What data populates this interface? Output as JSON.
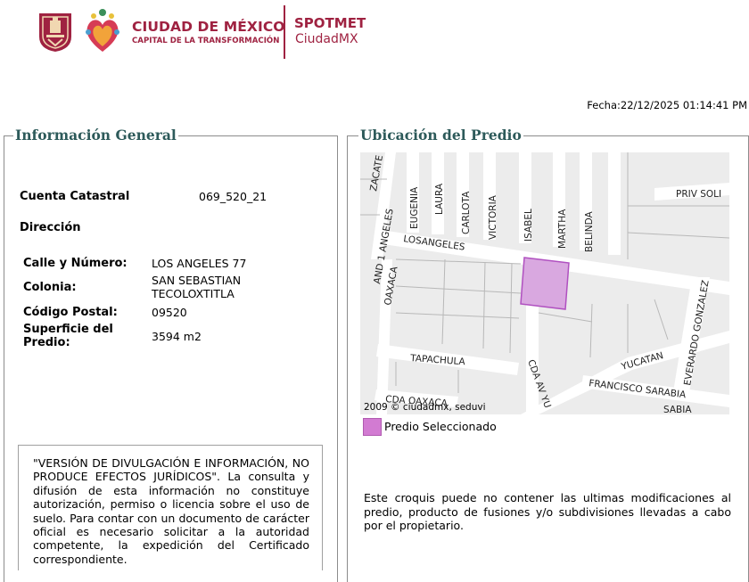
{
  "header": {
    "brand_title": "CIUDAD DE MÉXICO",
    "brand_subtitle": "CAPITAL DE LA TRANSFORMACIÓN",
    "app_title": "SPOTMET",
    "app_subtitle": "CiudadMX",
    "brand_color": "#9f2241",
    "icons": [
      "cdmx-crest-icon",
      "heart-emblem-icon"
    ]
  },
  "fecha": "Fecha:22/12/2025 01:14:41 PM",
  "info_general": {
    "legend": "Información General",
    "cuenta_label": "Cuenta Catastral",
    "cuenta_value": "069_520_21",
    "direccion_label": "Dirección",
    "calle_label": "Calle y Número:",
    "calle_value": "LOS ANGELES 77",
    "colonia_label": "Colonia:",
    "colonia_line1": "SAN SEBASTIAN",
    "colonia_line2": "TECOLOXTITLA",
    "cp_label": "Código Postal:",
    "cp_value": "09520",
    "superficie_label_1": "Superficie del",
    "superficie_label_2": "Predio:",
    "superficie_value": "3594 m2"
  },
  "disclaimer": "\"VERSIÓN DE DIVULGACIÓN E INFORMACIÓN, NO PRODUCE EFECTOS JURÍDICOS\". La consulta y difusión de esta información no constituye autorización, permiso o licencia sobre el uso de suelo. Para contar con un documento de carácter oficial es necesario solicitar a la autoridad competente, la expedición del Certificado correspondiente.",
  "ubicacion": {
    "legend": "Ubicación del Predio",
    "copyright": "2009 © ciudadmx, seduvi",
    "legend_label": "Predio Seleccionado",
    "selected_color": "#d27bd2",
    "note": "Este croquis puede no contener las ultimas modificaciones al predio, producto de fusiones y/o subdivisiones llevadas a cabo por el propietario.",
    "streets": {
      "zacatecas": "ZACATE",
      "angeles_v": "AND 1 ANGELES",
      "eugenia": "EUGENIA",
      "laura": "LAURA",
      "carlota": "CARLOTA",
      "victoria": "VICTORIA",
      "isabel": "ISABEL",
      "martha": "MARTHA",
      "belinda": "BELINDA",
      "priv_sol": "PRIV SOLI",
      "losangeles": "LOSANGELES",
      "oaxaca": "OAXACA",
      "everardo": "EVERARDO GONZALEZ",
      "yucatan": "YUCATAN",
      "tapachula": "TAPACHULA",
      "francisco": "FRANCISCO SARABIA",
      "cda_yu": "CDA AV YU",
      "cda_oaxaca": "CDA OAXACA",
      "sabia": "SABIA"
    }
  }
}
